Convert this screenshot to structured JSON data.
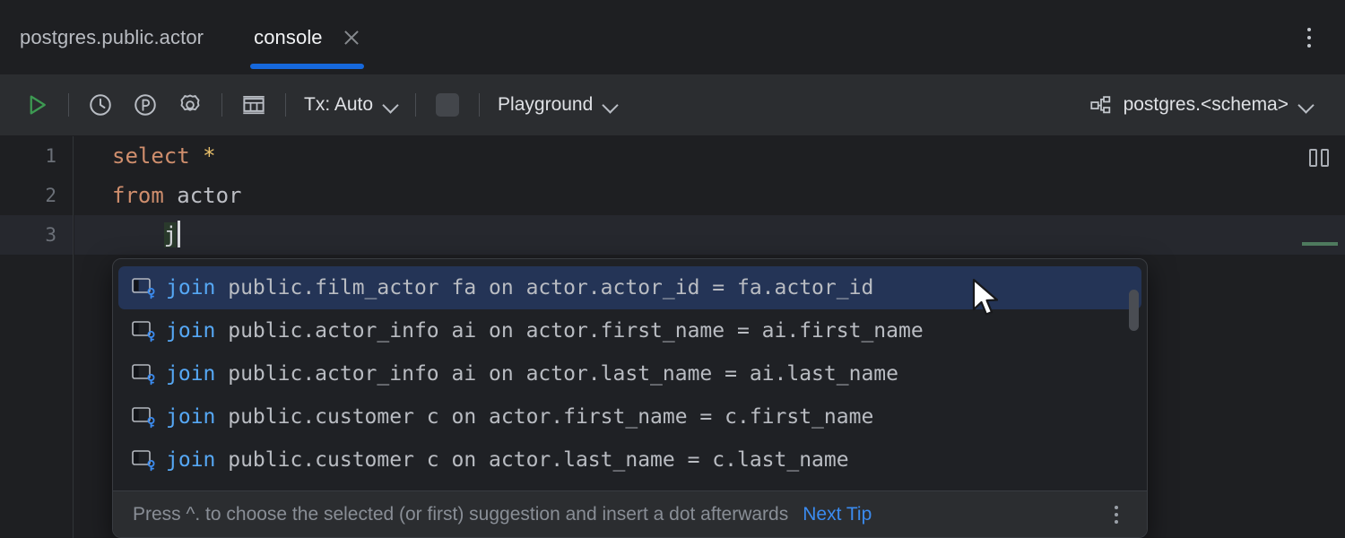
{
  "window": {
    "tabs": [
      {
        "label": "postgres.public.actor",
        "active": false,
        "closable": false
      },
      {
        "label": "console",
        "active": true,
        "closable": true
      }
    ],
    "more_menu_icon": "kebab-vertical-icon"
  },
  "toolbar": {
    "run_icon": "play-run-icon",
    "history_icon": "clock-history-icon",
    "parameters_icon": "circled-p-icon",
    "settings_icon": "gear-icon",
    "table_icon": "table-grid-icon",
    "tx_label": "Tx: Auto",
    "stop_icon": "stop-square-icon",
    "schema_switcher_label": "Playground",
    "datasource_icon": "database-schema-icon",
    "datasource_label": "postgres.<schema>",
    "chevron_icon": "chevron-down-icon",
    "accent_blue": "#1668dc",
    "run_green": "#3d9a52"
  },
  "editor": {
    "line_numbers": [
      "1",
      "2",
      "3"
    ],
    "lines": [
      {
        "keyword": "select",
        "rest": " ",
        "star": "*"
      },
      {
        "keyword": "from",
        "rest": " actor"
      },
      {
        "indent": "    ",
        "typed_prefix": "j"
      }
    ],
    "split_icon": "split-editor-icon",
    "keyword_color": "#cf8e6d",
    "star_color": "#e8bf6a",
    "text_color": "#bcbec4"
  },
  "autocomplete": {
    "item_icon": "join-table-key-icon",
    "items": [
      {
        "keyword": "join",
        "text": " public.film_actor fa on actor.actor_id = fa.actor_id",
        "selected": true
      },
      {
        "keyword": "join",
        "text": " public.actor_info ai on actor.first_name = ai.first_name",
        "selected": false
      },
      {
        "keyword": "join",
        "text": " public.actor_info ai on actor.last_name = ai.last_name",
        "selected": false
      },
      {
        "keyword": "join",
        "text": " public.customer c on actor.first_name = c.first_name",
        "selected": false
      },
      {
        "keyword": "join",
        "text": " public.customer c on actor.last_name = c.last_name",
        "selected": false
      }
    ],
    "selected_bg": "#243456",
    "keyword_color": "#56a8f5",
    "hint_text": "Press ^. to choose the selected (or first) suggestion and insert a dot afterwards",
    "hint_link": "Next Tip",
    "hint_menu_icon": "kebab-vertical-icon",
    "scrollbar": "vertical-scrollbar"
  },
  "cursor": {
    "icon": "mouse-pointer-icon"
  }
}
